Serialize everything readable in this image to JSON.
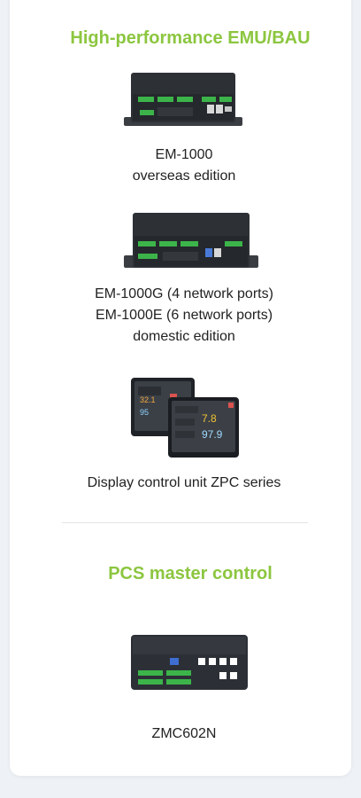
{
  "sections": {
    "emu": {
      "title": "High-performance EMU/BAU",
      "products": [
        {
          "lines": [
            "EM-1000",
            "overseas edition"
          ]
        },
        {
          "lines": [
            "EM-1000G (4 network ports)",
            "EM-1000E (6 network ports)",
            "domestic edition"
          ]
        },
        {
          "lines": [
            "Display control unit ZPC series"
          ]
        }
      ]
    },
    "pcs": {
      "title": "PCS master control",
      "products": [
        {
          "lines": [
            "ZMC602N"
          ]
        }
      ]
    }
  },
  "images": {
    "em1000": "EM-1000 device photo",
    "em1000g": "EM-1000G/E device photo",
    "zpc": "ZPC display control unit photo",
    "zmc602n": "ZMC602N device photo"
  },
  "screen_values": {
    "value_a": "32.1",
    "value_b": "95",
    "value_c": "7.8",
    "value_d": "97.9"
  },
  "colors": {
    "accent": "#8cc63f",
    "text": "#222222",
    "background": "#eef2f6"
  }
}
